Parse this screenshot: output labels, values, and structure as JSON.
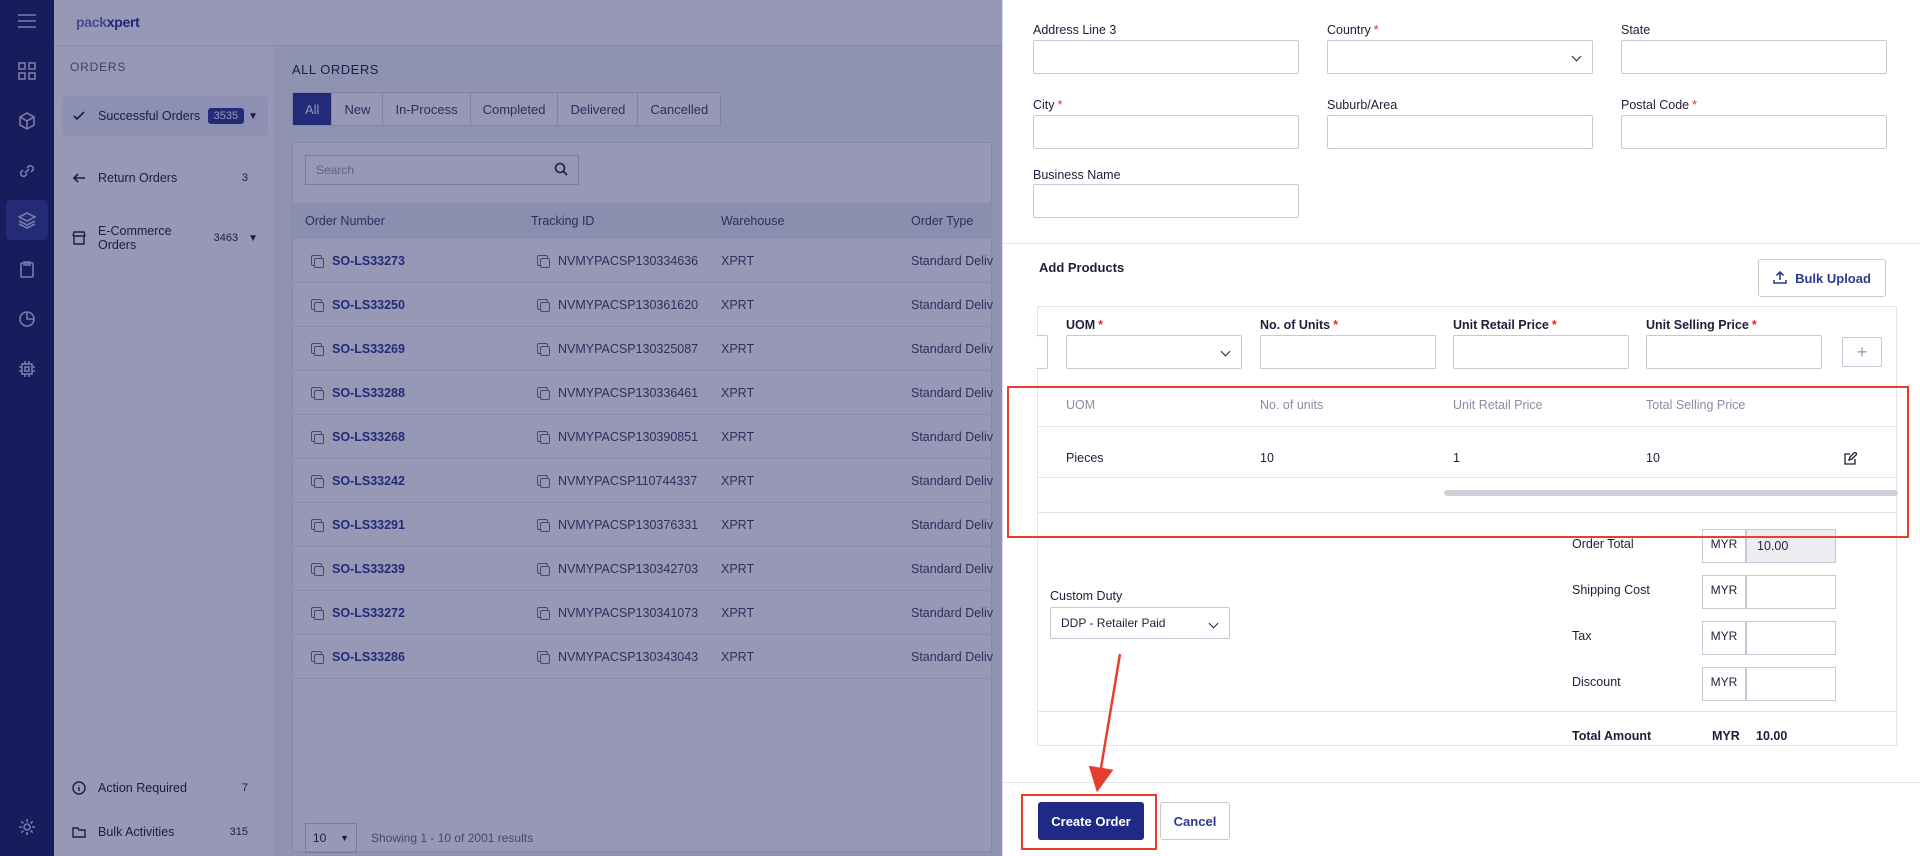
{
  "app": {
    "logo_text_a": "pack",
    "logo_text_b": "xpert"
  },
  "sidebar": {
    "header": "ORDERS",
    "items": [
      {
        "label": "Successful Orders",
        "count": "3535"
      },
      {
        "label": "Return Orders",
        "count": "3"
      },
      {
        "label": "E-Commerce Orders",
        "count": "3463"
      }
    ],
    "bottom": [
      {
        "label": "Action Required",
        "count": "7"
      },
      {
        "label": "Bulk Activities",
        "count": "315"
      }
    ]
  },
  "main": {
    "title": "ALL ORDERS",
    "tabs": [
      "All",
      "New",
      "In-Process",
      "Completed",
      "Delivered",
      "Cancelled"
    ],
    "search_placeholder": "Search",
    "columns": [
      "Order Number",
      "Tracking ID",
      "Warehouse",
      "Order Type"
    ],
    "rows": [
      {
        "order": "SO-LS33273",
        "tracking": "NVMYPACSP130334636",
        "warehouse": "XPRT",
        "type": "Standard Delivery"
      },
      {
        "order": "SO-LS33250",
        "tracking": "NVMYPACSP130361620",
        "warehouse": "XPRT",
        "type": "Standard Delivery"
      },
      {
        "order": "SO-LS33269",
        "tracking": "NVMYPACSP130325087",
        "warehouse": "XPRT",
        "type": "Standard Delivery"
      },
      {
        "order": "SO-LS33288",
        "tracking": "NVMYPACSP130336461",
        "warehouse": "XPRT",
        "type": "Standard Delivery"
      },
      {
        "order": "SO-LS33268",
        "tracking": "NVMYPACSP130390851",
        "warehouse": "XPRT",
        "type": "Standard Delivery"
      },
      {
        "order": "SO-LS33242",
        "tracking": "NVMYPACSP110744337",
        "warehouse": "XPRT",
        "type": "Standard Delivery"
      },
      {
        "order": "SO-LS33291",
        "tracking": "NVMYPACSP130376331",
        "warehouse": "XPRT",
        "type": "Standard Delivery"
      },
      {
        "order": "SO-LS33239",
        "tracking": "NVMYPACSP130342703",
        "warehouse": "XPRT",
        "type": "Standard Delivery"
      },
      {
        "order": "SO-LS33272",
        "tracking": "NVMYPACSP130341073",
        "warehouse": "XPRT",
        "type": "Standard Delivery"
      },
      {
        "order": "SO-LS33286",
        "tracking": "NVMYPACSP130343043",
        "warehouse": "XPRT",
        "type": "Standard Delivery"
      }
    ],
    "page_size": "10",
    "showing": "Showing 1 - 10 of 2001 results"
  },
  "drawer": {
    "address3": "Address Line 3",
    "country": "Country",
    "state": "State",
    "city": "City",
    "suburb": "Suburb/Area",
    "postal": "Postal Code",
    "business": "Business Name",
    "add_products": "Add Products",
    "bulk_upload": "Bulk Upload",
    "uom": "UOM",
    "units": "No. of Units",
    "retail": "Unit Retail Price",
    "selling": "Unit Selling Price",
    "table_headers": [
      "UOM",
      "No. of units",
      "Unit Retail Price",
      "Total Selling Price"
    ],
    "table_row": [
      "Pieces",
      "10",
      "1",
      "10"
    ],
    "custom_duty_label": "Custom Duty",
    "custom_duty_value": "DDP - Retailer Paid",
    "currency": "MYR",
    "order_total_label": "Order Total",
    "order_total_value": "10.00",
    "shipping_label": "Shipping Cost",
    "tax_label": "Tax",
    "discount_label": "Discount",
    "total_amount_label": "Total Amount",
    "total_amount_value": "10.00",
    "create_order": "Create Order",
    "cancel": "Cancel"
  },
  "colors": {
    "primary": "#1f2a86",
    "rail": "#1b1d5e",
    "highlight": "#e5402f"
  }
}
